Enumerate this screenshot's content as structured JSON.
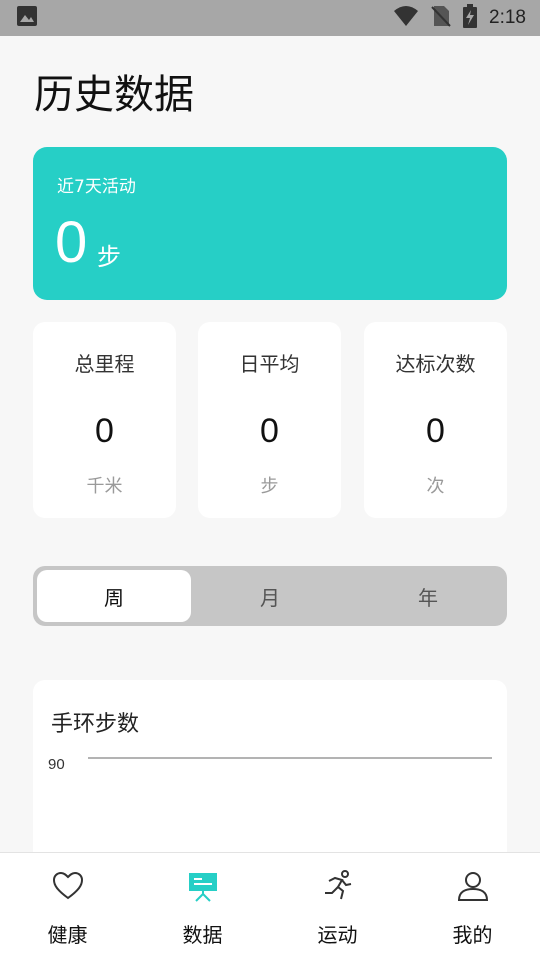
{
  "status_bar": {
    "time": "2:18",
    "icons": [
      "image-icon",
      "wifi-icon",
      "no-sim-icon",
      "battery-charging-icon"
    ]
  },
  "page": {
    "title": "历史数据"
  },
  "summary_card": {
    "label": "近7天活动",
    "value": "0",
    "unit": "步",
    "color": "#26cfc6"
  },
  "stats": [
    {
      "label": "总里程",
      "value": "0",
      "unit": "千米"
    },
    {
      "label": "日平均",
      "value": "0",
      "unit": "步"
    },
    {
      "label": "达标次数",
      "value": "0",
      "unit": "次"
    }
  ],
  "period_tabs": {
    "items": [
      "周",
      "月",
      "年"
    ],
    "selected": "周"
  },
  "chart": {
    "title": "手环步数"
  },
  "chart_data": {
    "type": "line",
    "title": "手环步数",
    "ytick_labels": [
      "90"
    ],
    "series": []
  },
  "bottom_nav": {
    "items": [
      {
        "label": "健康",
        "icon": "heart-icon",
        "active": false
      },
      {
        "label": "数据",
        "icon": "chart-board-icon",
        "active": true
      },
      {
        "label": "运动",
        "icon": "running-icon",
        "active": false
      },
      {
        "label": "我的",
        "icon": "person-icon",
        "active": false
      }
    ],
    "active_color": "#26cfc6"
  }
}
